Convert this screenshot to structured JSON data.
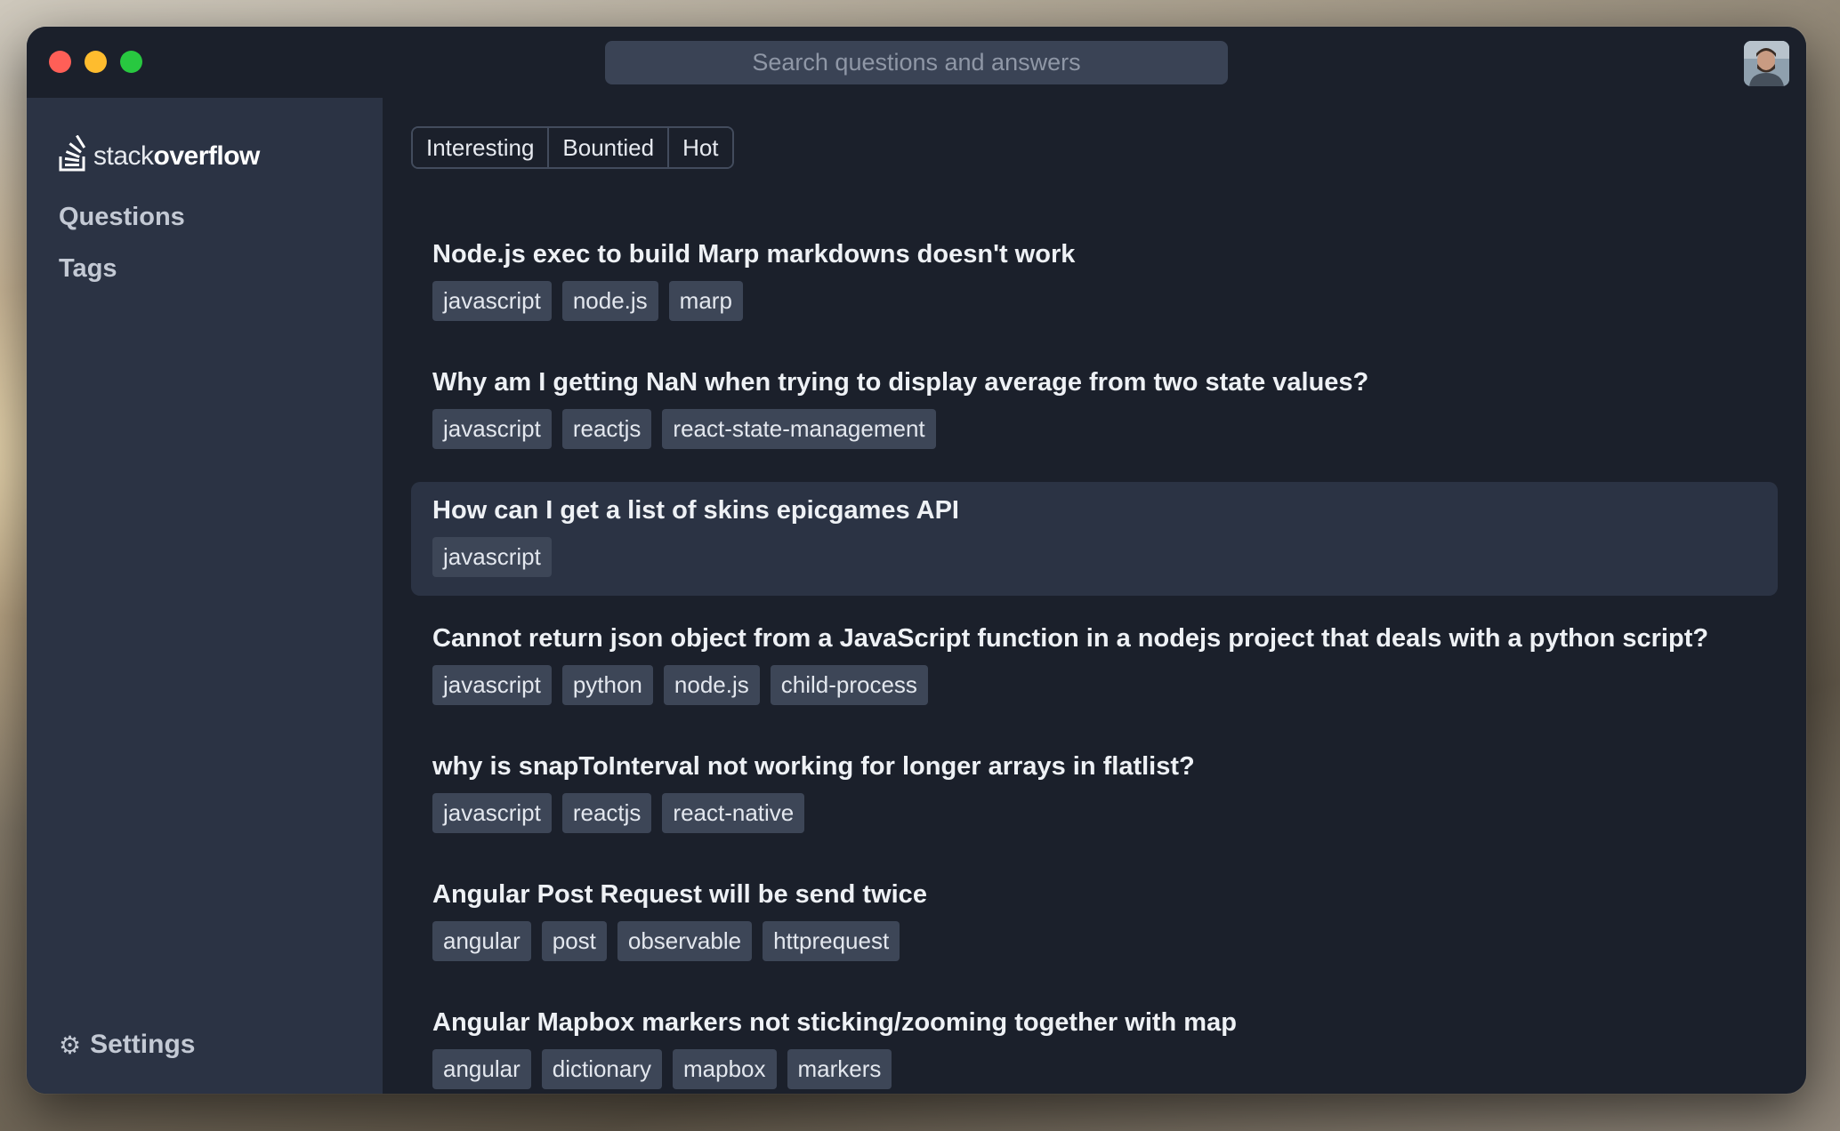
{
  "search": {
    "placeholder": "Search questions and answers"
  },
  "sidebar": {
    "logo": {
      "light": "stack",
      "bold": "overflow",
      "icon": "stackoverflow-logo-icon"
    },
    "items": [
      {
        "label": "Questions"
      },
      {
        "label": "Tags"
      }
    ],
    "settings": {
      "label": "Settings",
      "icon": "gear-icon"
    }
  },
  "tabs": [
    {
      "label": "Interesting"
    },
    {
      "label": "Bountied"
    },
    {
      "label": "Hot"
    }
  ],
  "questions": [
    {
      "title": "Node.js exec to build Marp markdowns doesn't work",
      "tags": [
        "javascript",
        "node.js",
        "marp"
      ]
    },
    {
      "title": "Why am I getting NaN when trying to display average from two state values?",
      "tags": [
        "javascript",
        "reactjs",
        "react-state-management"
      ]
    },
    {
      "title": "How can I get a list of skins epicgames API",
      "tags": [
        "javascript"
      ]
    },
    {
      "title": "Cannot return json object from a JavaScript function in a nodejs project that deals with a python script?",
      "tags": [
        "javascript",
        "python",
        "node.js",
        "child-process"
      ]
    },
    {
      "title": "why is snapToInterval not working for longer arrays in flatlist?",
      "tags": [
        "javascript",
        "reactjs",
        "react-native"
      ]
    },
    {
      "title": "Angular Post Request will be send twice",
      "tags": [
        "angular",
        "post",
        "observable",
        "httprequest"
      ]
    },
    {
      "title": "Angular Mapbox markers not sticking/zooming together with map",
      "tags": [
        "angular",
        "dictionary",
        "mapbox",
        "markers"
      ]
    }
  ]
}
